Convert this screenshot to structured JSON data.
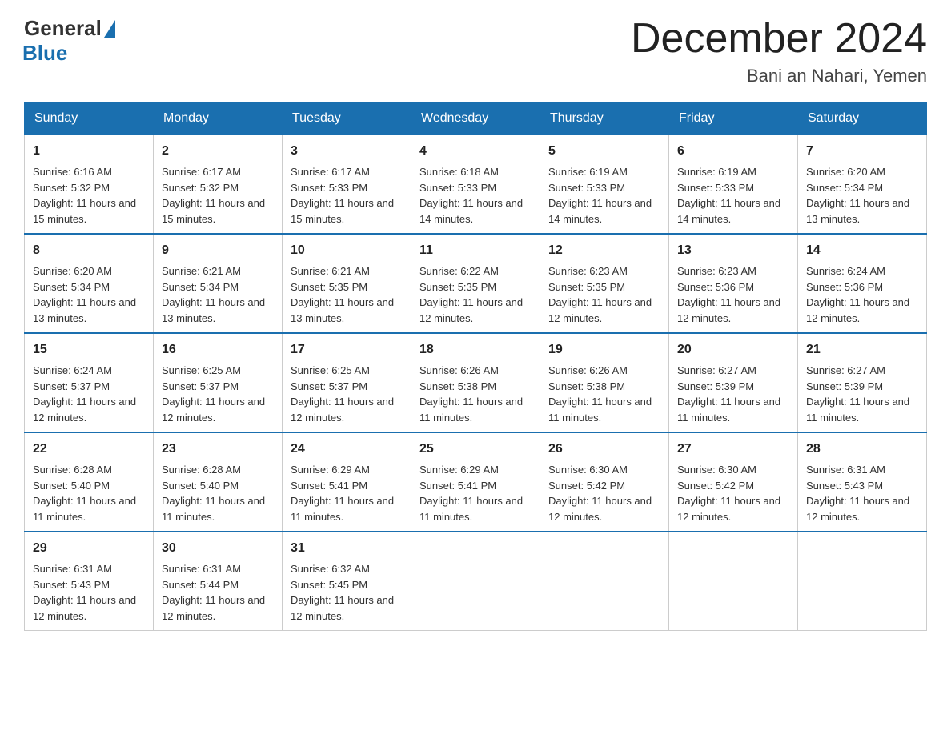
{
  "header": {
    "logo_general": "General",
    "logo_blue": "Blue",
    "month_title": "December 2024",
    "location": "Bani an Nahari, Yemen"
  },
  "days_of_week": [
    "Sunday",
    "Monday",
    "Tuesday",
    "Wednesday",
    "Thursday",
    "Friday",
    "Saturday"
  ],
  "weeks": [
    [
      {
        "day": "1",
        "sunrise": "6:16 AM",
        "sunset": "5:32 PM",
        "daylight": "11 hours and 15 minutes."
      },
      {
        "day": "2",
        "sunrise": "6:17 AM",
        "sunset": "5:32 PM",
        "daylight": "11 hours and 15 minutes."
      },
      {
        "day": "3",
        "sunrise": "6:17 AM",
        "sunset": "5:33 PM",
        "daylight": "11 hours and 15 minutes."
      },
      {
        "day": "4",
        "sunrise": "6:18 AM",
        "sunset": "5:33 PM",
        "daylight": "11 hours and 14 minutes."
      },
      {
        "day": "5",
        "sunrise": "6:19 AM",
        "sunset": "5:33 PM",
        "daylight": "11 hours and 14 minutes."
      },
      {
        "day": "6",
        "sunrise": "6:19 AM",
        "sunset": "5:33 PM",
        "daylight": "11 hours and 14 minutes."
      },
      {
        "day": "7",
        "sunrise": "6:20 AM",
        "sunset": "5:34 PM",
        "daylight": "11 hours and 13 minutes."
      }
    ],
    [
      {
        "day": "8",
        "sunrise": "6:20 AM",
        "sunset": "5:34 PM",
        "daylight": "11 hours and 13 minutes."
      },
      {
        "day": "9",
        "sunrise": "6:21 AM",
        "sunset": "5:34 PM",
        "daylight": "11 hours and 13 minutes."
      },
      {
        "day": "10",
        "sunrise": "6:21 AM",
        "sunset": "5:35 PM",
        "daylight": "11 hours and 13 minutes."
      },
      {
        "day": "11",
        "sunrise": "6:22 AM",
        "sunset": "5:35 PM",
        "daylight": "11 hours and 12 minutes."
      },
      {
        "day": "12",
        "sunrise": "6:23 AM",
        "sunset": "5:35 PM",
        "daylight": "11 hours and 12 minutes."
      },
      {
        "day": "13",
        "sunrise": "6:23 AM",
        "sunset": "5:36 PM",
        "daylight": "11 hours and 12 minutes."
      },
      {
        "day": "14",
        "sunrise": "6:24 AM",
        "sunset": "5:36 PM",
        "daylight": "11 hours and 12 minutes."
      }
    ],
    [
      {
        "day": "15",
        "sunrise": "6:24 AM",
        "sunset": "5:37 PM",
        "daylight": "11 hours and 12 minutes."
      },
      {
        "day": "16",
        "sunrise": "6:25 AM",
        "sunset": "5:37 PM",
        "daylight": "11 hours and 12 minutes."
      },
      {
        "day": "17",
        "sunrise": "6:25 AM",
        "sunset": "5:37 PM",
        "daylight": "11 hours and 12 minutes."
      },
      {
        "day": "18",
        "sunrise": "6:26 AM",
        "sunset": "5:38 PM",
        "daylight": "11 hours and 11 minutes."
      },
      {
        "day": "19",
        "sunrise": "6:26 AM",
        "sunset": "5:38 PM",
        "daylight": "11 hours and 11 minutes."
      },
      {
        "day": "20",
        "sunrise": "6:27 AM",
        "sunset": "5:39 PM",
        "daylight": "11 hours and 11 minutes."
      },
      {
        "day": "21",
        "sunrise": "6:27 AM",
        "sunset": "5:39 PM",
        "daylight": "11 hours and 11 minutes."
      }
    ],
    [
      {
        "day": "22",
        "sunrise": "6:28 AM",
        "sunset": "5:40 PM",
        "daylight": "11 hours and 11 minutes."
      },
      {
        "day": "23",
        "sunrise": "6:28 AM",
        "sunset": "5:40 PM",
        "daylight": "11 hours and 11 minutes."
      },
      {
        "day": "24",
        "sunrise": "6:29 AM",
        "sunset": "5:41 PM",
        "daylight": "11 hours and 11 minutes."
      },
      {
        "day": "25",
        "sunrise": "6:29 AM",
        "sunset": "5:41 PM",
        "daylight": "11 hours and 11 minutes."
      },
      {
        "day": "26",
        "sunrise": "6:30 AM",
        "sunset": "5:42 PM",
        "daylight": "11 hours and 12 minutes."
      },
      {
        "day": "27",
        "sunrise": "6:30 AM",
        "sunset": "5:42 PM",
        "daylight": "11 hours and 12 minutes."
      },
      {
        "day": "28",
        "sunrise": "6:31 AM",
        "sunset": "5:43 PM",
        "daylight": "11 hours and 12 minutes."
      }
    ],
    [
      {
        "day": "29",
        "sunrise": "6:31 AM",
        "sunset": "5:43 PM",
        "daylight": "11 hours and 12 minutes."
      },
      {
        "day": "30",
        "sunrise": "6:31 AM",
        "sunset": "5:44 PM",
        "daylight": "11 hours and 12 minutes."
      },
      {
        "day": "31",
        "sunrise": "6:32 AM",
        "sunset": "5:45 PM",
        "daylight": "11 hours and 12 minutes."
      },
      null,
      null,
      null,
      null
    ]
  ],
  "labels": {
    "sunrise_prefix": "Sunrise: ",
    "sunset_prefix": "Sunset: ",
    "daylight_prefix": "Daylight: "
  }
}
